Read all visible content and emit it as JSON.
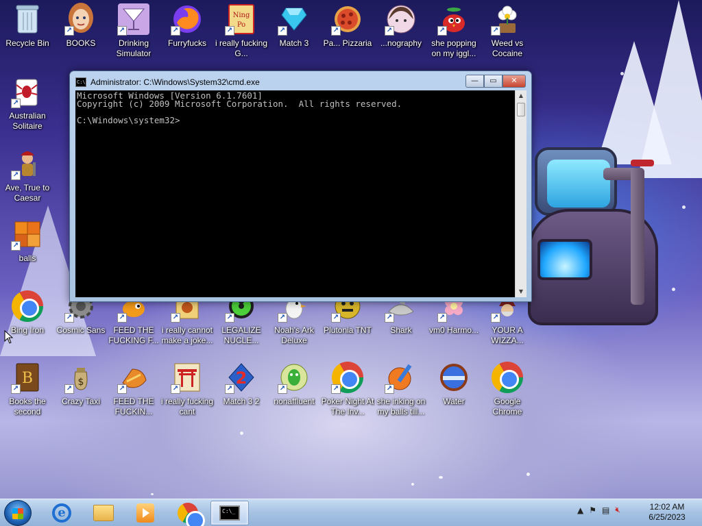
{
  "desktop": {
    "icons_row1": [
      {
        "label": "Recycle Bin",
        "icon": "recycle-bin-icon"
      },
      {
        "label": "BOOKS",
        "icon": "girl-face-icon"
      },
      {
        "label": "Drinking Simulator",
        "icon": "cocktail-icon"
      },
      {
        "label": "Furryfucks",
        "icon": "firefox-icon"
      },
      {
        "label": "i really fucking G...",
        "icon": "ning-po-icon"
      },
      {
        "label": "Match 3",
        "icon": "gem-icon"
      },
      {
        "label": "Pa... Pizzaria",
        "icon": "pizza-icon"
      },
      {
        "label": "...nography",
        "icon": "anime-girl-icon"
      },
      {
        "label": "she popping on my iggl...",
        "icon": "red-bird-icon"
      },
      {
        "label": "Weed vs Cocaine",
        "icon": "flower-icon"
      }
    ],
    "icons_col1": [
      {
        "label": "Australian Solitaire",
        "icon": "spider-icon"
      },
      {
        "label": "Ave, True to Caesar",
        "icon": "soldier-icon"
      },
      {
        "label": "balls",
        "icon": "orange-blocks-icon"
      },
      {
        "label": "Bing Iron",
        "icon": "chrome-icon"
      }
    ],
    "icons_row_mid": [
      {
        "label": "Cosmic Sans",
        "icon": "gear-icon"
      },
      {
        "label": "FEED THE FUCKING F...",
        "icon": "fish-icon"
      },
      {
        "label": "i really cannot make a joke...",
        "icon": "scroll-icon"
      },
      {
        "label": "LEGALIZE NUCLE...",
        "icon": "radiation-icon"
      },
      {
        "label": "Noah's Ark Deluxe",
        "icon": "bird-icon"
      },
      {
        "label": "Plutonia TNT",
        "icon": "doom-icon"
      },
      {
        "label": "Shark",
        "icon": "shark-icon"
      },
      {
        "label": "vm0 Harmo...",
        "icon": "flower-pink-icon"
      },
      {
        "label": "YOUR A WIZZA...",
        "icon": "wizard-icon"
      }
    ],
    "icons_row_bottom": [
      {
        "label": "Books the second",
        "icon": "book-icon"
      },
      {
        "label": "Crazy Taxi",
        "icon": "money-bag-icon"
      },
      {
        "label": "FEED THE FUCKIN...",
        "icon": "fish-icon"
      },
      {
        "label": "i really fucking cant",
        "icon": "torii-icon"
      },
      {
        "label": "Match 3 2",
        "icon": "number-two-icon"
      },
      {
        "label": "nonaffluent",
        "icon": "green-alien-icon"
      },
      {
        "label": "Poker Night At The Inv...",
        "icon": "chrome-icon"
      },
      {
        "label": "she inking on my balls till...",
        "icon": "pencil-ball-icon"
      },
      {
        "label": "Water",
        "icon": "water-ring-icon"
      },
      {
        "label": "Google Chrome",
        "icon": "chrome-icon"
      }
    ]
  },
  "cmd_window": {
    "title": "Administrator: C:\\Windows\\System32\\cmd.exe",
    "icon_text": "C:\\.",
    "line1": "Microsoft Windows [Version 6.1.7601]",
    "line2": "Copyright (c) 2009 Microsoft Corporation.  All rights reserved.",
    "line3": "",
    "line4": "C:\\Windows\\system32>",
    "minimize": "—",
    "maximize": "▭",
    "close": "✕"
  },
  "taskbar": {
    "cmd_text": "C:\\_",
    "tray_icons": [
      "show-hidden-icon",
      "flag-icon",
      "network-icon",
      "volume-muted-icon"
    ],
    "time": "12:02 AM",
    "date": "6/25/2023"
  }
}
